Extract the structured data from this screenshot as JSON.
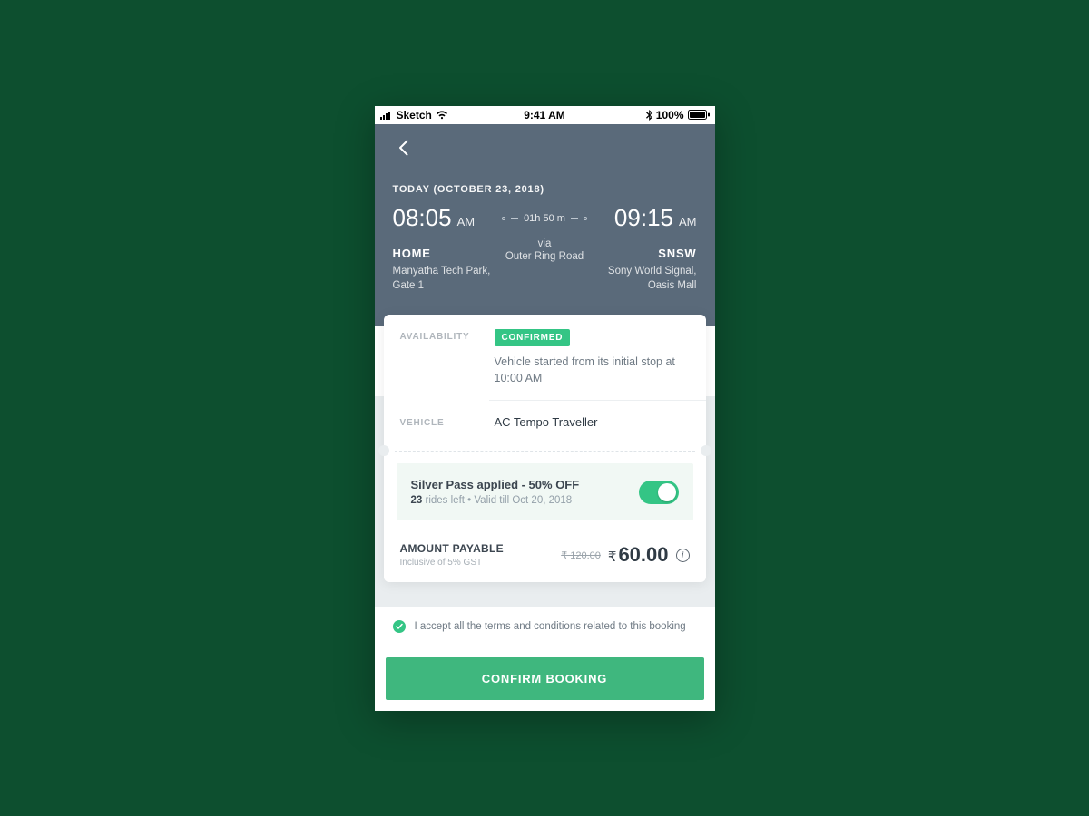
{
  "statusbar": {
    "carrier": "Sketch",
    "time": "9:41 AM",
    "battery": "100%"
  },
  "header": {
    "date_label": "TODAY (OCTOBER 23, 2018)",
    "depart": {
      "time": "08:05",
      "ampm": "AM",
      "name": "HOME",
      "sub": "Manyatha Tech Park, Gate 1"
    },
    "duration": "01h 50 m",
    "via_label": "via",
    "via_value": "Outer Ring Road",
    "arrive": {
      "time": "09:15",
      "ampm": "AM",
      "name": "SNSW",
      "sub": "Sony World Signal, Oasis Mall"
    }
  },
  "availability": {
    "label": "AVAILABILITY",
    "status": "CONFIRMED",
    "note": "Vehicle started from its initial stop at 10:00 AM"
  },
  "vehicle": {
    "label": "VEHICLE",
    "value": "AC Tempo Traveller"
  },
  "pass": {
    "title": "Silver Pass applied - 50% OFF",
    "rides_count": "23",
    "rides_suffix": " rides left • Valid till Oct 20, 2018"
  },
  "amount": {
    "label": "AMOUNT PAYABLE",
    "sub": "Inclusive of 5% GST",
    "old_price": "₹ 120.00",
    "new_price": "60.00"
  },
  "terms": {
    "text": "I accept all the terms and conditions related to this booking"
  },
  "cta": {
    "label": "CONFIRM BOOKING"
  }
}
